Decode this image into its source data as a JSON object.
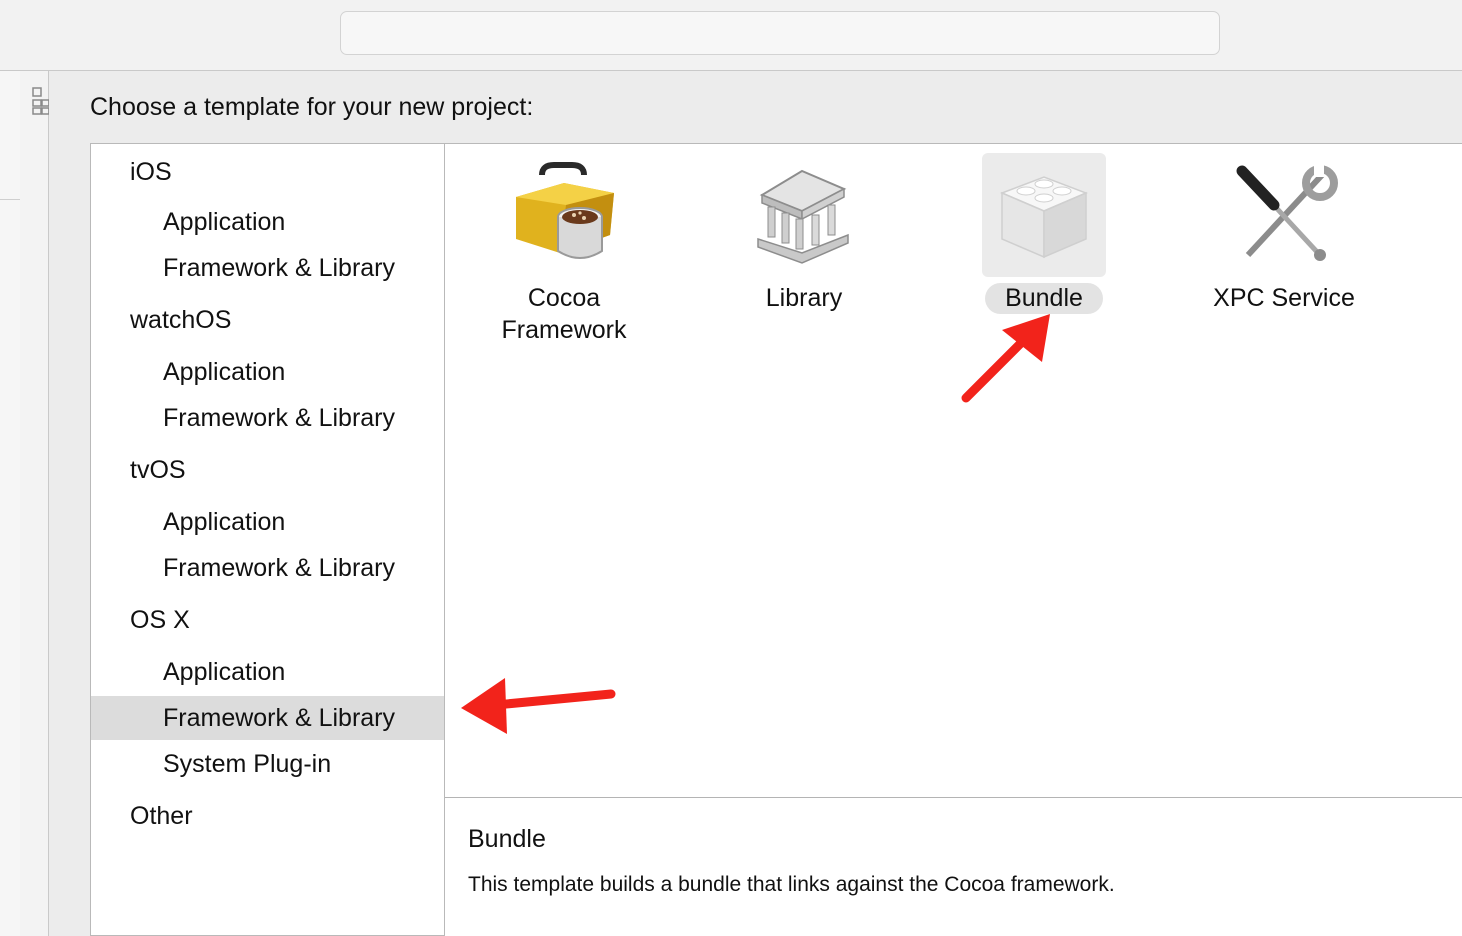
{
  "heading": "Choose a template for your new project:",
  "sidebar": {
    "items": [
      {
        "label": "iOS",
        "kind": "category"
      },
      {
        "label": "Application",
        "kind": "sub"
      },
      {
        "label": "Framework & Library",
        "kind": "sub"
      },
      {
        "label": "watchOS",
        "kind": "category"
      },
      {
        "label": "Application",
        "kind": "sub"
      },
      {
        "label": "Framework & Library",
        "kind": "sub"
      },
      {
        "label": "tvOS",
        "kind": "category"
      },
      {
        "label": "Application",
        "kind": "sub"
      },
      {
        "label": "Framework & Library",
        "kind": "sub"
      },
      {
        "label": "OS X",
        "kind": "category"
      },
      {
        "label": "Application",
        "kind": "sub"
      },
      {
        "label": "Framework & Library",
        "kind": "sub",
        "selected": true
      },
      {
        "label": "System Plug-in",
        "kind": "sub"
      },
      {
        "label": "Other",
        "kind": "category"
      }
    ]
  },
  "templates": [
    {
      "label_line1": "Cocoa",
      "label_line2": "Framework",
      "icon": "cocoa-toolbox-icon"
    },
    {
      "label_line1": "Library",
      "label_line2": "",
      "icon": "library-building-icon"
    },
    {
      "label_line1": "Bundle",
      "label_line2": "",
      "icon": "bundle-lego-icon",
      "selected": true
    },
    {
      "label_line1": "XPC Service",
      "label_line2": "",
      "icon": "xpc-tools-icon"
    }
  ],
  "description": {
    "title": "Bundle",
    "text": "This template builds a bundle that links against the Cocoa framework."
  },
  "annotations": {
    "arrow_color": "#f2231b"
  }
}
